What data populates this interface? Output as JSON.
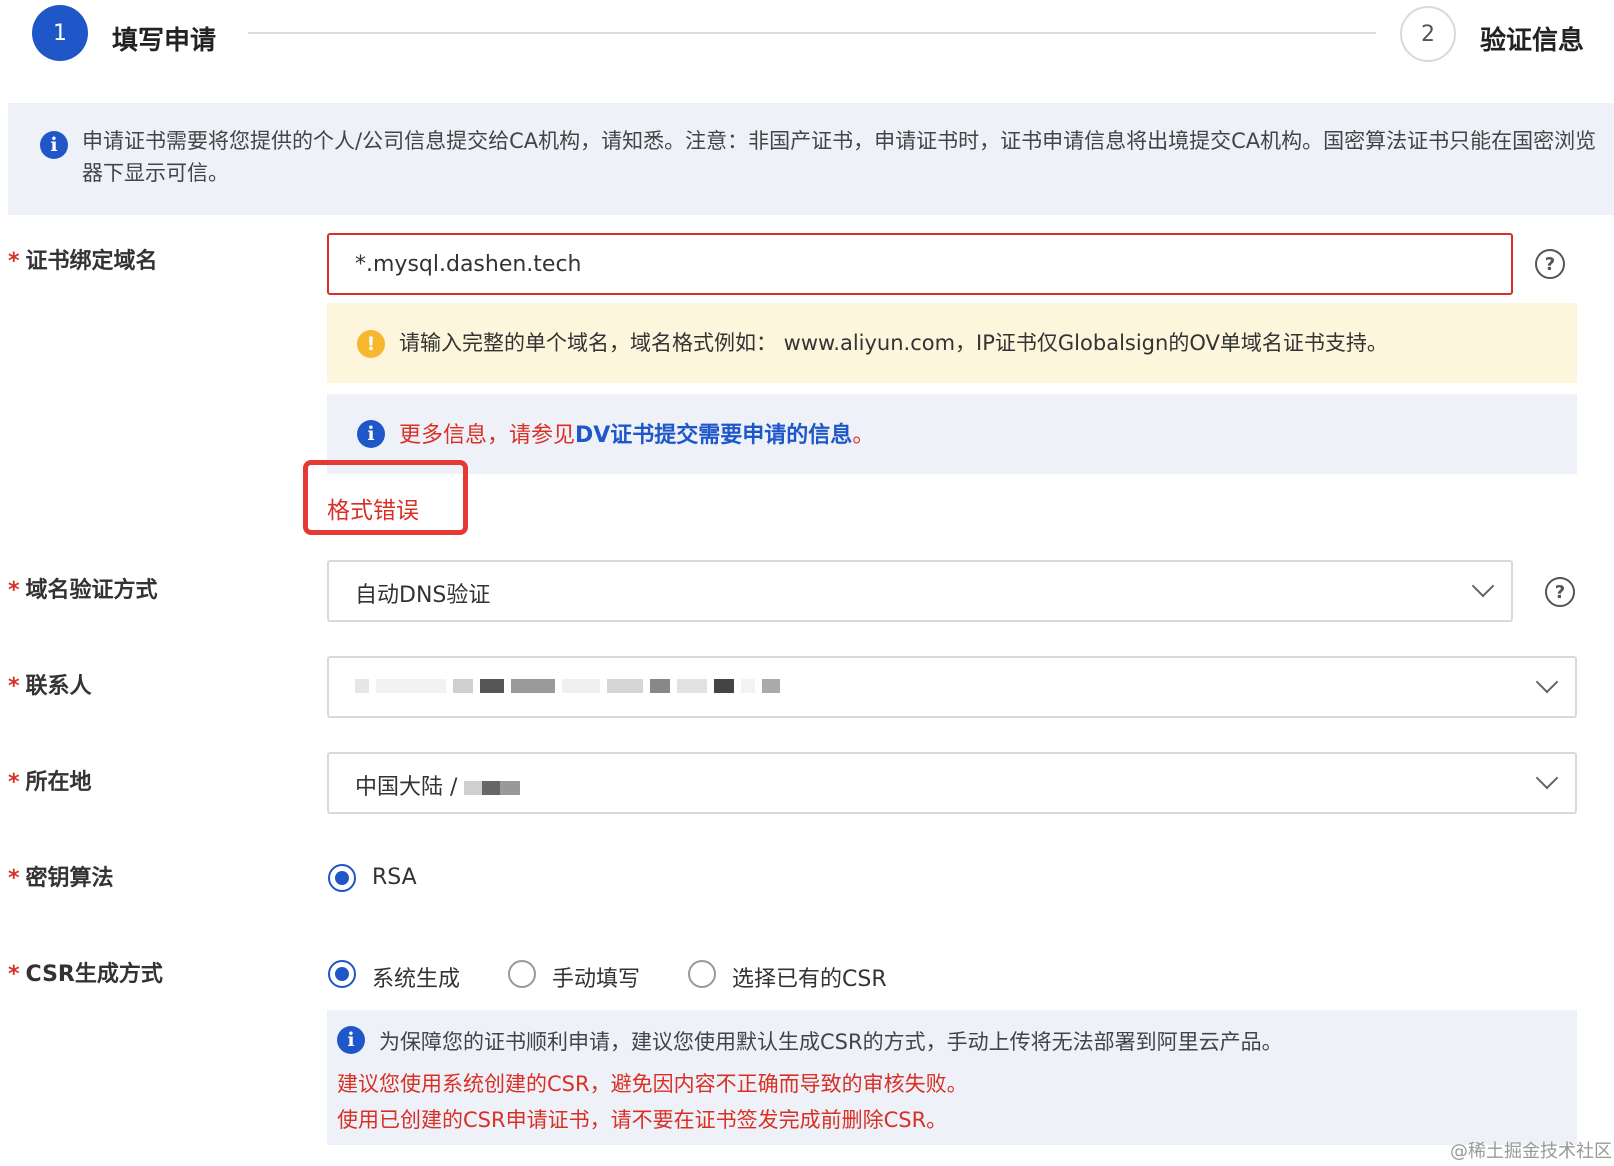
{
  "stepper": {
    "step1_number": "1",
    "step1_label": "填写申请",
    "step2_number": "2",
    "step2_label": "验证信息"
  },
  "banner": {
    "text": "申请证书需要将您提供的个人/公司信息提交给CA机构，请知悉。注意：非国产证书，申请证书时，证书申请信息将出境提交CA机构。国密算法证书只能在国密浏览器下显示可信。"
  },
  "form": {
    "domain": {
      "label": "证书绑定域名",
      "value": "*.mysql.dashen.tech",
      "warning": "请输入完整的单个域名，域名格式例如： www.aliyun.com，IP证书仅Globalsign的OV单域名证书支持。",
      "more_prefix": "更多信息，请参见",
      "more_link": "DV证书提交需要申请的信息",
      "more_suffix": "。",
      "error": "格式错误"
    },
    "verify_method": {
      "label": "域名验证方式",
      "value": "自动DNS验证"
    },
    "contact": {
      "label": "联系人"
    },
    "location": {
      "label": "所在地",
      "value": "中国大陆 / "
    },
    "key_algorithm": {
      "label": "密钥算法",
      "option": "RSA"
    },
    "csr": {
      "label": "CSR生成方式",
      "options": [
        "系统生成",
        "手动填写",
        "选择已有的CSR"
      ],
      "selected": "系统生成",
      "note_line1": "为保障您的证书顺利申请，建议您使用默认生成CSR的方式，手动上传将无法部署到阿里云产品。",
      "note_line2": "建议您使用系统创建的CSR，避免因内容不正确而导致的审核失败。",
      "note_line3": "使用已创建的CSR申请证书，请不要在证书签发完成前删除CSR。"
    }
  },
  "required_mark": "*",
  "watermark": "@稀土掘金技术社区",
  "colors": {
    "primary": "#1f57c9",
    "error": "#d93026",
    "warning_bg": "#fdf5dc",
    "info_bg": "#eef2f8"
  }
}
